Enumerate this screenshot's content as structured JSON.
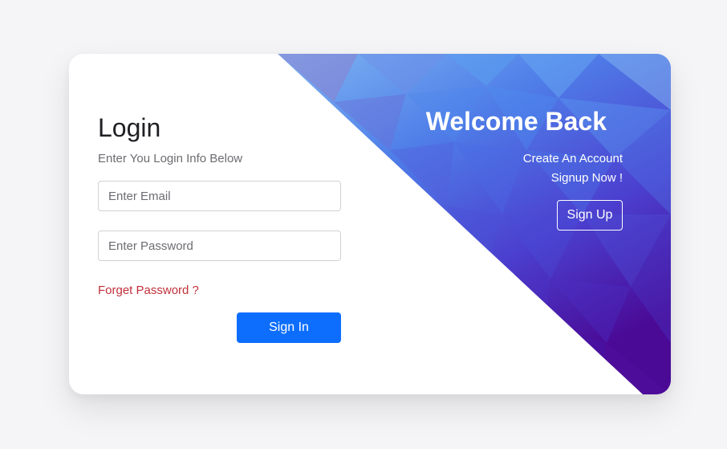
{
  "login": {
    "title": "Login",
    "subtitle": "Enter You Login Info Below",
    "email_placeholder": "Enter Email",
    "password_placeholder": "Enter Password",
    "forget_label": "Forget Password ?",
    "signin_label": "Sign In"
  },
  "welcome": {
    "title": "Welcome Back",
    "line1": "Create An Account",
    "line2": "Signup Now !",
    "signup_label": "Sign Up"
  },
  "colors": {
    "primary_button": "#0d6efd",
    "forget_link": "#c0303a",
    "gradient_start": "#4da6f5",
    "gradient_mid": "#4b4fd8",
    "gradient_end": "#4b0a9a"
  }
}
